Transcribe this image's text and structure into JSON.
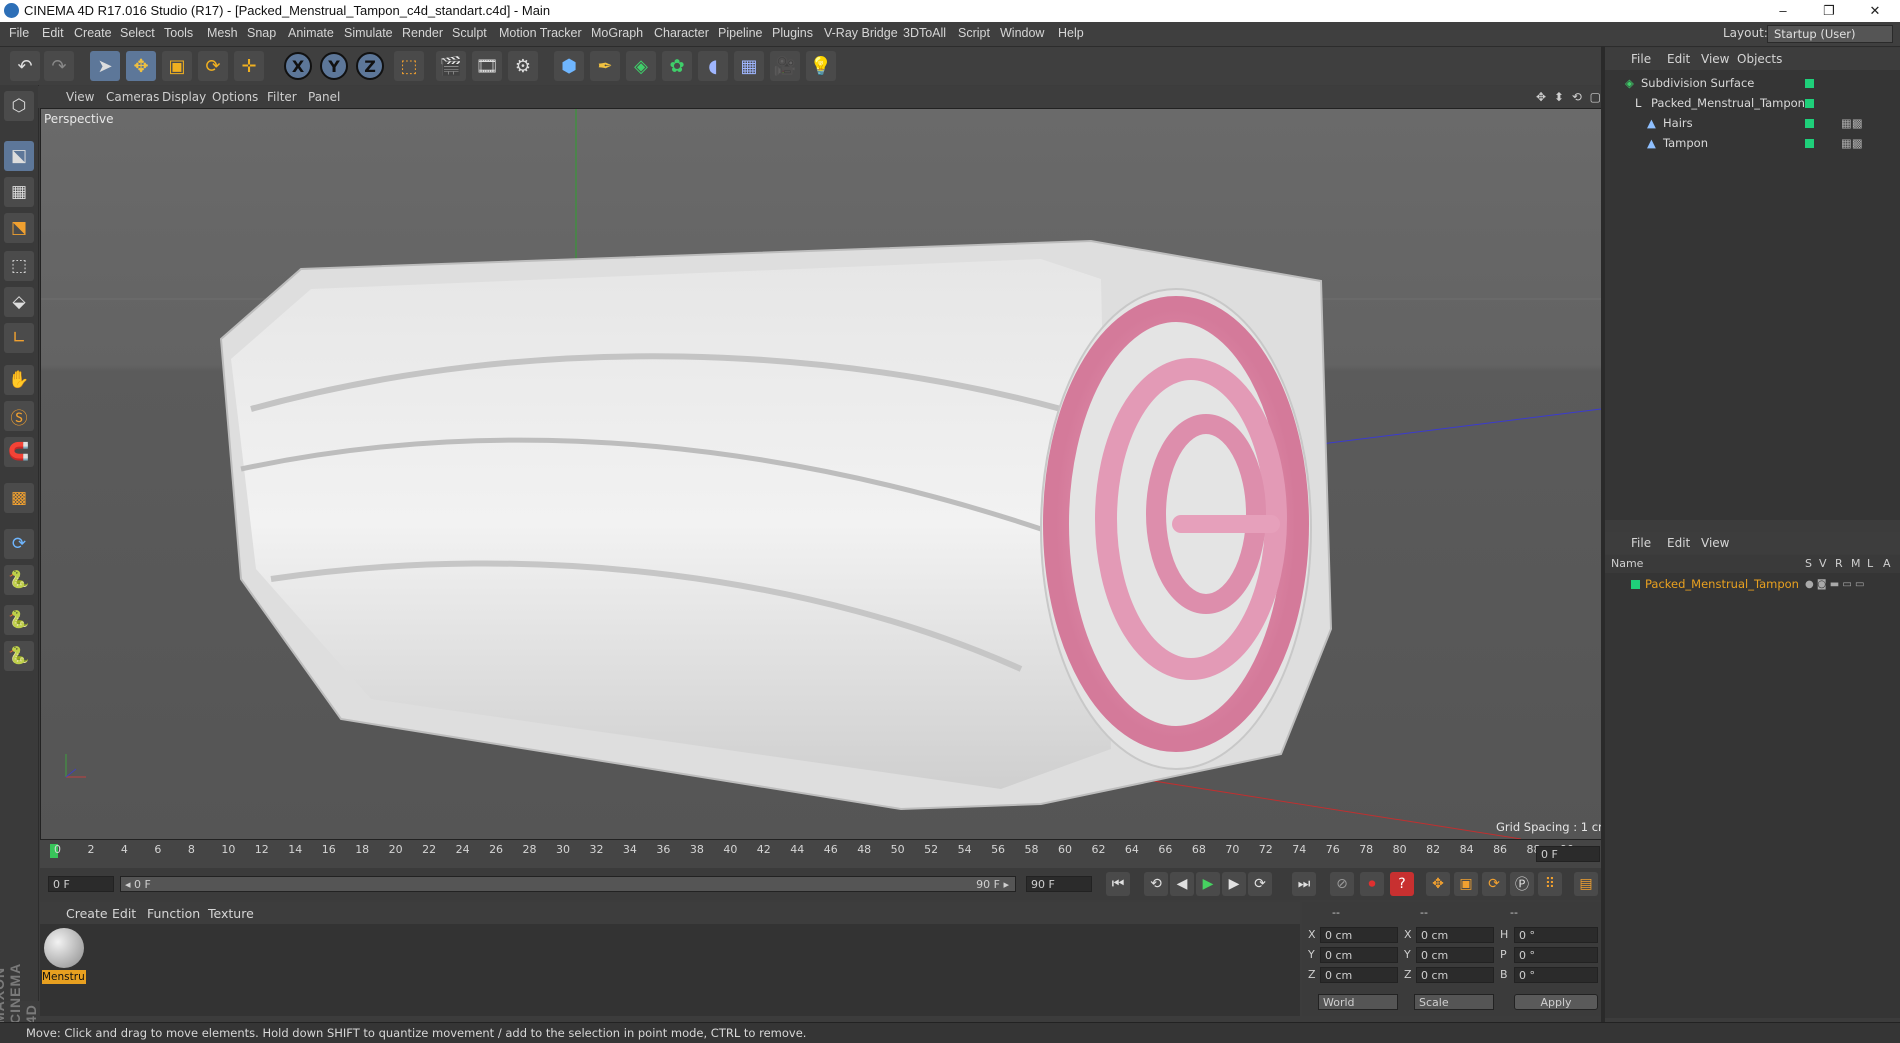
{
  "window": {
    "title": "CINEMA 4D R17.016 Studio (R17) - [Packed_Menstrual_Tampon_c4d_standart.c4d] - Main",
    "minimize": "–",
    "maximize": "❐",
    "close": "✕"
  },
  "menubar": [
    "File",
    "Edit",
    "Create",
    "Select",
    "Tools",
    "Mesh",
    "Snap",
    "Animate",
    "Simulate",
    "Render",
    "Sculpt",
    "Motion Tracker",
    "MoGraph",
    "Character",
    "Pipeline",
    "Plugins",
    "V-Ray Bridge",
    "3DToAll",
    "Script",
    "Window",
    "Help"
  ],
  "layout": {
    "label": "Layout:",
    "value": "Startup (User)"
  },
  "toolbar": {
    "undo": "↶",
    "redo": "↷",
    "pointer": "➤",
    "move": "✥",
    "scale": "▣",
    "rotate": "⟳",
    "transform": "✛",
    "x": "X",
    "y": "Y",
    "z": "Z",
    "coord": "⬚",
    "render_view": "🎬",
    "render_pv": "🎞",
    "render_settings": "⚙",
    "cube": "⬢",
    "pen": "✒",
    "subdiv": "◈",
    "cloner": "✿",
    "deformer": "◖",
    "floor": "▦",
    "camera": "🎥",
    "light": "💡"
  },
  "lefttools": [
    "⬡",
    "⬕",
    "▦",
    "⬔",
    "⬚",
    "⬙",
    "∟",
    "✋",
    "Ⓢ",
    "🧲",
    "▩",
    "⟳",
    "🐍",
    "🐍"
  ],
  "viewport": {
    "menu": [
      "View",
      "Cameras",
      "Display",
      "Options",
      "Filter",
      "Panel"
    ],
    "label": "Perspective",
    "grid_spacing": "Grid Spacing : 1 cm",
    "nav_icons": "✥ ⬍ ⟲ ▢"
  },
  "timeline": {
    "ticks": [
      "0",
      "2",
      "4",
      "6",
      "8",
      "10",
      "12",
      "14",
      "16",
      "18",
      "20",
      "22",
      "24",
      "26",
      "28",
      "30",
      "32",
      "34",
      "36",
      "38",
      "40",
      "42",
      "44",
      "46",
      "48",
      "50",
      "52",
      "54",
      "56",
      "58",
      "60",
      "62",
      "64",
      "66",
      "68",
      "70",
      "72",
      "74",
      "76",
      "78",
      "80",
      "82",
      "84",
      "86",
      "88",
      "90"
    ],
    "current_frame": "0 F",
    "start": "0 F",
    "range_start": "◂ 0 F",
    "range_end": "90 F ▸",
    "end": "90 F",
    "right_field": "0 F"
  },
  "playback": [
    "⏮",
    "⟲",
    "◀",
    "▶",
    "▶",
    "⟳",
    "⏭"
  ],
  "keys": [
    "⊘",
    "⏺",
    "?",
    "✥",
    "▣",
    "⟳",
    "Ⓟ",
    "⠿",
    "▤"
  ],
  "material_manager": {
    "menu": [
      "Create",
      "Edit",
      "Function",
      "Texture"
    ],
    "material_name": "Menstru"
  },
  "brand": "MAXON CINEMA 4D",
  "coordinates": {
    "headers": [
      "--",
      "--",
      "--"
    ],
    "rows": [
      {
        "a": "X",
        "v1": "0 cm",
        "b": "X",
        "v2": "0 cm",
        "c": "H",
        "v3": "0 °"
      },
      {
        "a": "Y",
        "v1": "0 cm",
        "b": "Y",
        "v2": "0 cm",
        "c": "P",
        "v3": "0 °"
      },
      {
        "a": "Z",
        "v1": "0 cm",
        "b": "Z",
        "v2": "0 cm",
        "c": "B",
        "v3": "0 °"
      }
    ],
    "mode": "World",
    "size_mode": "Scale",
    "apply": "Apply"
  },
  "objects_panel": {
    "menu": [
      "File",
      "Edit",
      "View",
      "Objects"
    ],
    "items": [
      {
        "name": "Subdivision Surface",
        "indent": 0
      },
      {
        "name": "Packed_Menstrual_Tampon",
        "indent": 1
      },
      {
        "name": "Hairs",
        "indent": 2
      },
      {
        "name": "Tampon",
        "indent": 2
      }
    ]
  },
  "layers_panel": {
    "menu": [
      "File",
      "Edit",
      "View"
    ],
    "columns": [
      "Name",
      "S",
      "V",
      "R",
      "M",
      "L",
      "A"
    ],
    "items": [
      {
        "name": "Packed_Menstrual_Tampon",
        "color": "#e8a020"
      }
    ]
  },
  "status": "Move: Click and drag to move elements. Hold down SHIFT to quantize movement / add to the selection in point mode, CTRL to remove."
}
